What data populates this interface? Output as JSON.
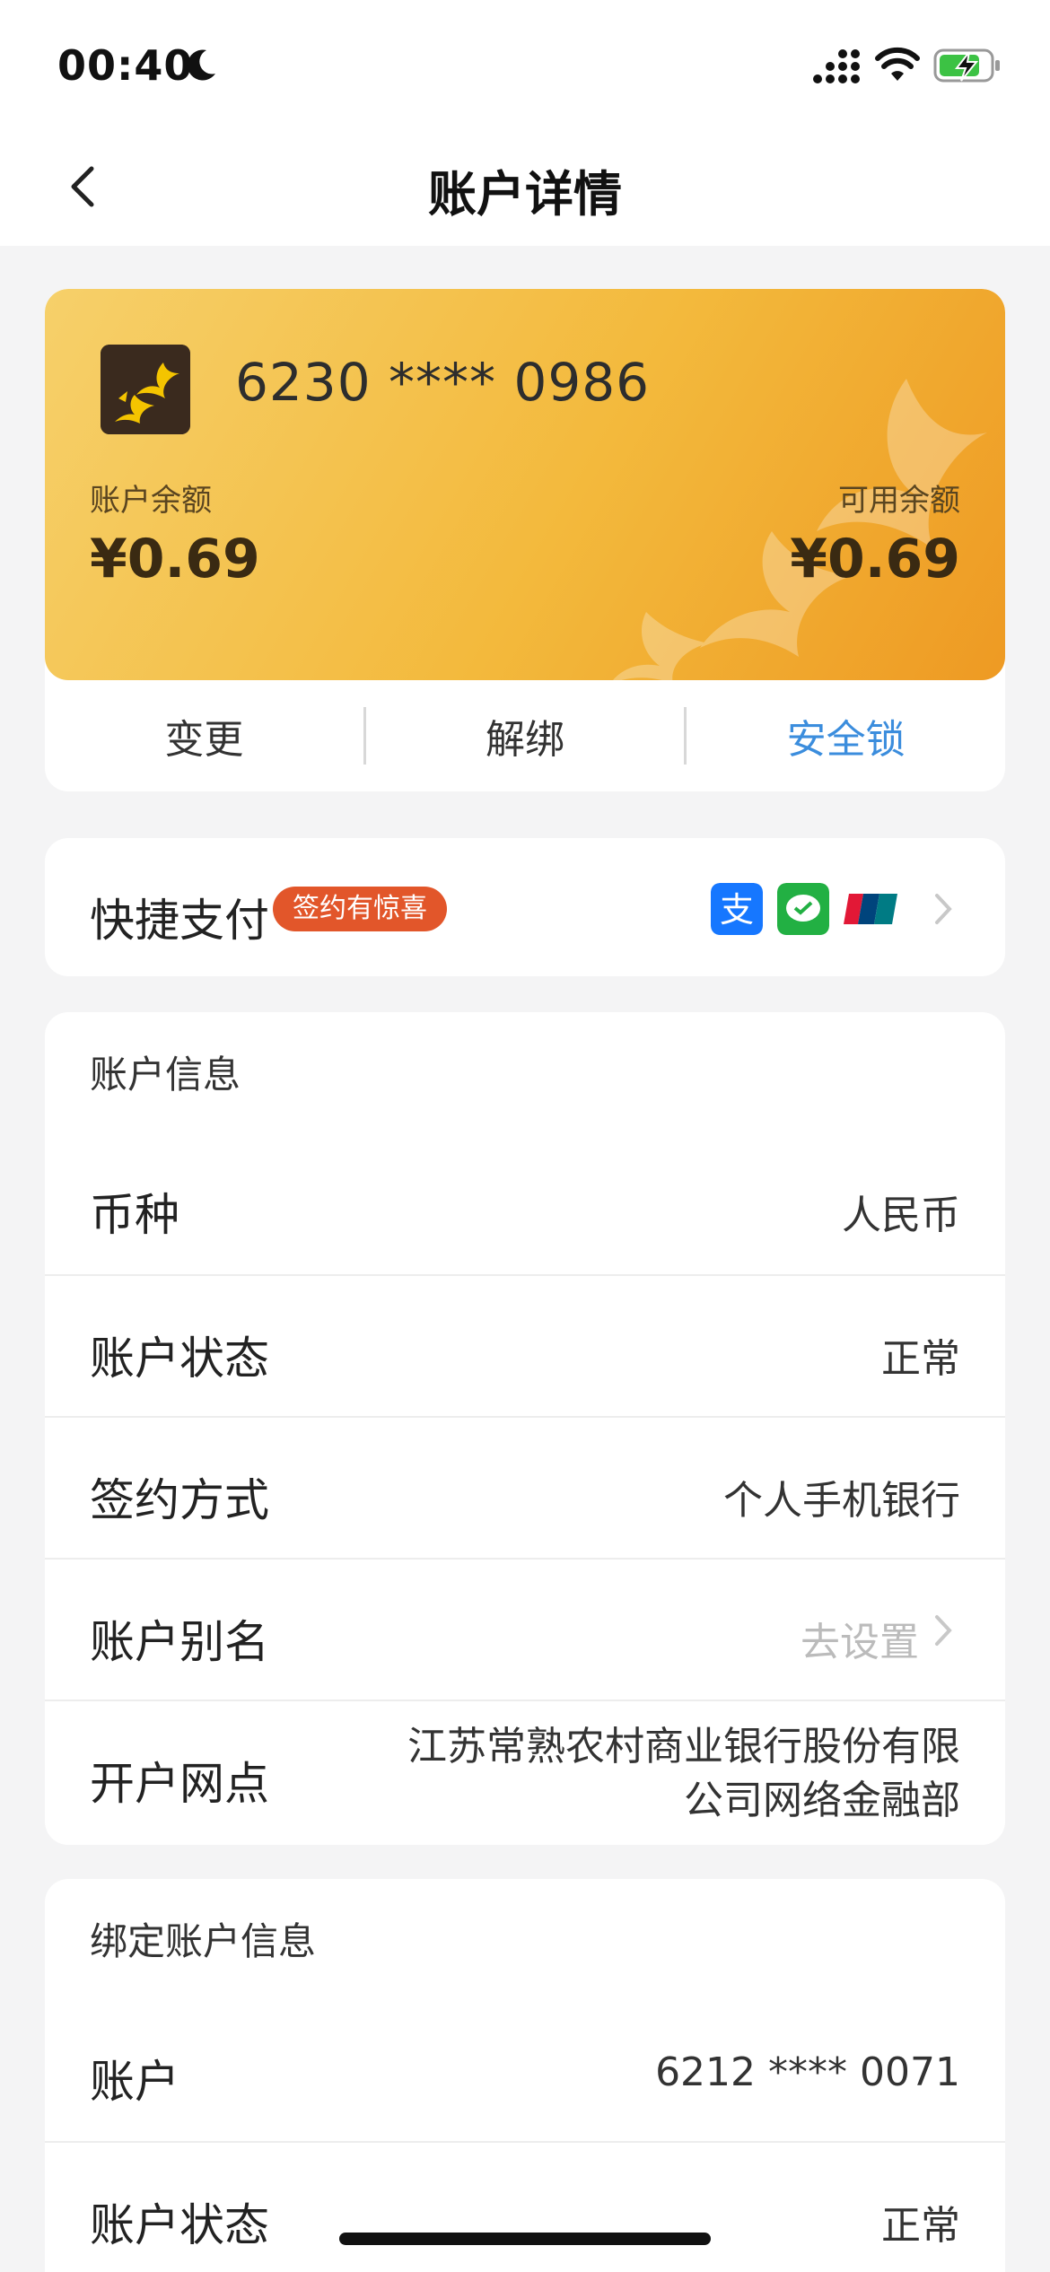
{
  "status_bar": {
    "time": "00:40"
  },
  "nav": {
    "title": "账户详情"
  },
  "card": {
    "number": "6230 **** 0986",
    "balance_label": "账户余额",
    "balance": "¥0.69",
    "available_label": "可用余额",
    "available": "¥0.69",
    "actions": [
      "变更",
      "解绑",
      "安全锁"
    ]
  },
  "quick_pay": {
    "title": "快捷支付",
    "badge": "签约有惊喜",
    "icons": [
      "alipay-icon",
      "wechat-pay-icon",
      "unionpay-icon"
    ]
  },
  "account_info": {
    "header": "账户信息",
    "rows": [
      {
        "label": "币种",
        "value": "人民币"
      },
      {
        "label": "账户状态",
        "value": "正常"
      },
      {
        "label": "签约方式",
        "value": "个人手机银行"
      },
      {
        "label": "账户别名",
        "value": "去设置"
      },
      {
        "label": "开户网点",
        "value_line1": "江苏常熟农村商业银行股份有限",
        "value_line2": "公司网络金融部"
      }
    ]
  },
  "bound_account": {
    "header": "绑定账户信息",
    "rows": [
      {
        "label": "账户",
        "value": "6212 **** 0071"
      },
      {
        "label": "账户状态",
        "value": "正常"
      }
    ]
  },
  "colors": {
    "accent_blue": "#3b8ddd",
    "badge_red": "#e2562a",
    "card_gold": "#f3b93c"
  }
}
